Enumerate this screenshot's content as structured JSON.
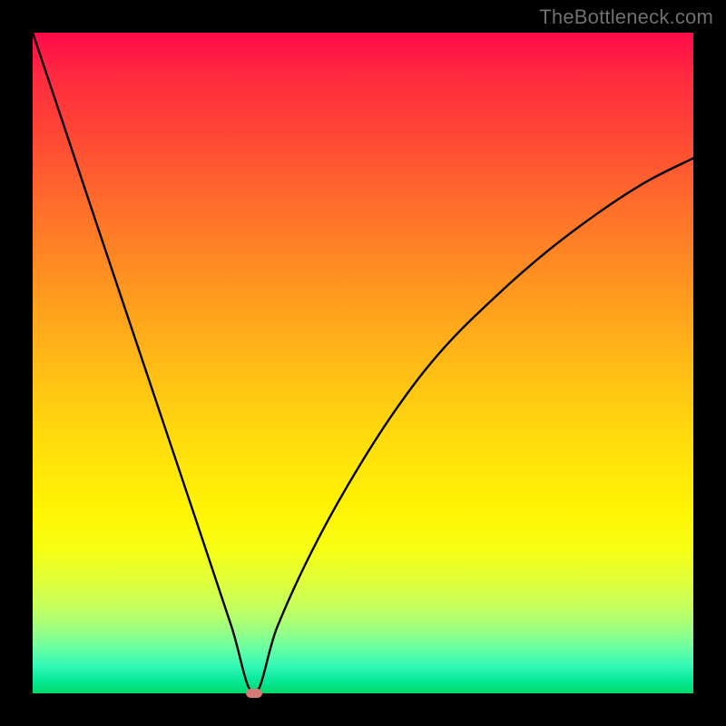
{
  "watermark": "TheBottleneck.com",
  "colors": {
    "frame": "#000000",
    "curve": "#000000",
    "min_marker": "#d47a77"
  },
  "chart_data": {
    "type": "line",
    "title": "",
    "xlabel": "",
    "ylabel": "",
    "xlim": [
      0,
      100
    ],
    "ylim": [
      0,
      100
    ],
    "gradient_meaning": "vertical gradient red(top)=high bottleneck, green(bottom)=low bottleneck",
    "min_point": {
      "x": 33.5,
      "y": 0
    },
    "series": [
      {
        "name": "bottleneck-curve",
        "x": [
          0,
          5,
          10,
          15,
          20,
          25,
          30,
          33.5,
          37,
          42,
          48,
          55,
          62,
          70,
          78,
          86,
          93,
          100
        ],
        "values": [
          100,
          85.1,
          70.1,
          55.2,
          40.3,
          25.4,
          10.4,
          0,
          10,
          21,
          32,
          43,
          52,
          60,
          67,
          73,
          77.5,
          81
        ]
      }
    ]
  }
}
